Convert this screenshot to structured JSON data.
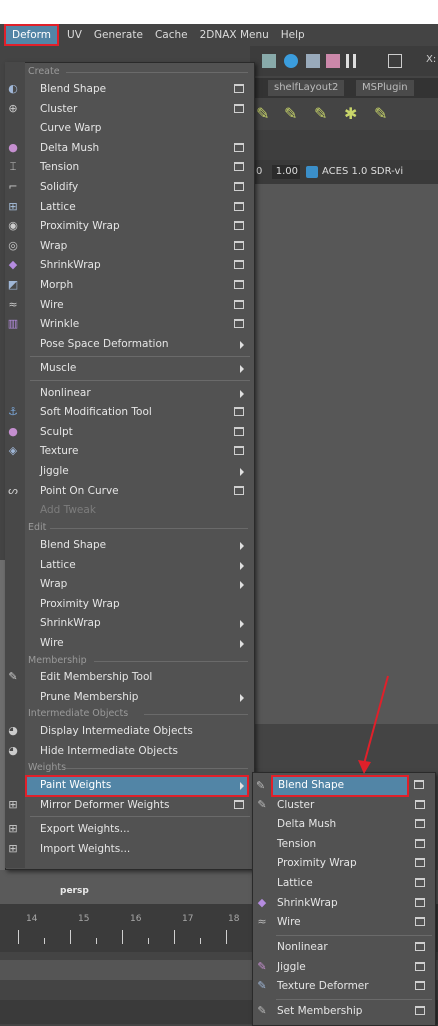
{
  "menubar": {
    "items": [
      "Deform",
      "UV",
      "Generate",
      "Cache",
      "2DNAX Menu",
      "Help"
    ]
  },
  "background": {
    "toolbar_text": "X:",
    "shelf_tabs": [
      "shelfLayout2",
      "MSPlugin"
    ],
    "panel_values": [
      "0",
      "1.00",
      "ACES 1.0 SDR-vi"
    ],
    "viewport_label": "persp",
    "timeline_ticks": [
      "14",
      "15",
      "16",
      "17",
      "18"
    ]
  },
  "deform_menu": {
    "section_create": "Create",
    "create_items": [
      {
        "label": "Blend Shape",
        "option": true,
        "submenu": false,
        "icon": "blend-shape-icon"
      },
      {
        "label": "Cluster",
        "option": true,
        "submenu": false,
        "icon": "cluster-icon"
      },
      {
        "label": "Curve Warp",
        "option": false,
        "submenu": false,
        "icon": ""
      },
      {
        "label": "Delta Mush",
        "option": true,
        "submenu": false,
        "icon": "delta-mush-icon"
      },
      {
        "label": "Tension",
        "option": true,
        "submenu": false,
        "icon": "tension-icon"
      },
      {
        "label": "Solidify",
        "option": true,
        "submenu": false,
        "icon": "solidify-icon"
      },
      {
        "label": "Lattice",
        "option": true,
        "submenu": false,
        "icon": "lattice-icon"
      },
      {
        "label": "Proximity Wrap",
        "option": true,
        "submenu": false,
        "icon": "proximity-wrap-icon"
      },
      {
        "label": "Wrap",
        "option": true,
        "submenu": false,
        "icon": "wrap-icon"
      },
      {
        "label": "ShrinkWrap",
        "option": true,
        "submenu": false,
        "icon": "shrinkwrap-icon"
      },
      {
        "label": "Morph",
        "option": true,
        "submenu": false,
        "icon": "morph-icon"
      },
      {
        "label": "Wire",
        "option": true,
        "submenu": false,
        "icon": "wire-icon"
      },
      {
        "label": "Wrinkle",
        "option": true,
        "submenu": false,
        "icon": "wrinkle-icon"
      },
      {
        "label": "Pose Space Deformation",
        "option": false,
        "submenu": true,
        "icon": ""
      }
    ],
    "muscle": "Muscle",
    "create_items_2": [
      {
        "label": "Nonlinear",
        "option": false,
        "submenu": true,
        "icon": ""
      },
      {
        "label": "Soft Modification Tool",
        "option": true,
        "submenu": false,
        "icon": "soft-mod-icon"
      },
      {
        "label": "Sculpt",
        "option": true,
        "submenu": false,
        "icon": "sculpt-icon"
      },
      {
        "label": "Texture",
        "option": true,
        "submenu": false,
        "icon": "texture-icon"
      },
      {
        "label": "Jiggle",
        "option": false,
        "submenu": true,
        "icon": ""
      },
      {
        "label": "Point On Curve",
        "option": true,
        "submenu": false,
        "icon": "point-on-curve-icon"
      },
      {
        "label": "Add Tweak",
        "option": false,
        "submenu": false,
        "icon": "",
        "disabled": true
      }
    ],
    "section_edit": "Edit",
    "edit_items": [
      {
        "label": "Blend Shape",
        "submenu": true
      },
      {
        "label": "Lattice",
        "submenu": true
      },
      {
        "label": "Wrap",
        "submenu": true
      },
      {
        "label": "Proximity Wrap",
        "submenu": false
      },
      {
        "label": "ShrinkWrap",
        "submenu": true
      },
      {
        "label": "Wire",
        "submenu": true
      }
    ],
    "section_membership": "Membership",
    "membership_items": [
      {
        "label": "Edit Membership Tool",
        "submenu": false,
        "icon": "membership-tool-icon"
      },
      {
        "label": "Prune Membership",
        "submenu": true,
        "icon": ""
      }
    ],
    "section_intermediate": "Intermediate Objects",
    "intermediate_items": [
      {
        "label": "Display Intermediate Objects",
        "icon": "display-intermediate-icon"
      },
      {
        "label": "Hide Intermediate Objects",
        "icon": "hide-intermediate-icon"
      }
    ],
    "section_weights": "Weights",
    "weights_items": [
      {
        "label": "Paint Weights",
        "submenu": true,
        "highlighted": true
      },
      {
        "label": "Mirror Deformer Weights",
        "option": true,
        "icon": "mirror-weights-icon"
      },
      {
        "label": "Export Weights...",
        "icon": "export-weights-icon"
      },
      {
        "label": "Import Weights...",
        "icon": "import-weights-icon"
      }
    ]
  },
  "paint_weights_submenu": {
    "items": [
      {
        "label": "Blend Shape",
        "icon": "paint-blend-icon",
        "highlighted": true
      },
      {
        "label": "Cluster",
        "icon": "paint-cluster-icon"
      },
      {
        "label": "Delta Mush",
        "icon": ""
      },
      {
        "label": "Tension",
        "icon": ""
      },
      {
        "label": "Proximity Wrap",
        "icon": ""
      },
      {
        "label": "Lattice",
        "icon": ""
      },
      {
        "label": "ShrinkWrap",
        "icon": "paint-shrinkwrap-icon"
      },
      {
        "label": "Wire",
        "icon": "paint-wire-icon"
      }
    ],
    "items_2": [
      {
        "label": "Nonlinear",
        "icon": ""
      },
      {
        "label": "Jiggle",
        "icon": "paint-jiggle-icon"
      },
      {
        "label": "Texture Deformer",
        "icon": "paint-texture-icon"
      }
    ],
    "items_3": [
      {
        "label": "Set Membership",
        "icon": "paint-membership-icon"
      }
    ]
  },
  "colors": {
    "highlight": "#5285a6",
    "annotation_red": "#e0202a",
    "menu_bg": "#525252"
  }
}
